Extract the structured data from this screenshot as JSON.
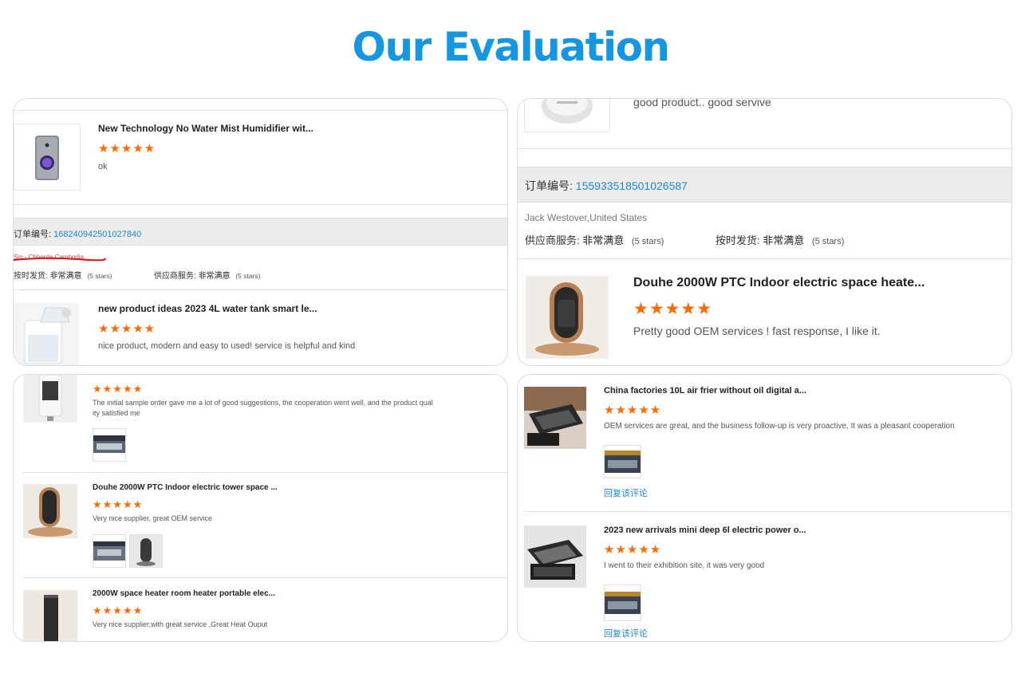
{
  "page": {
    "title": "Our Evaluation"
  },
  "card1": {
    "review1": {
      "name": "New Technology No Water Mist Humidifier wit...",
      "stars": "★★★★★",
      "text": "ok"
    },
    "order": {
      "label": "订单编号:",
      "number": "168240942501027840"
    },
    "buyer": "Sin - Chhorda,Cambodia",
    "ratings": {
      "delivery_label": "按时发货:",
      "delivery_value": "非常满意",
      "delivery_stars": "(5 stars)",
      "service_label": "供应商服务:",
      "service_value": "非常满意",
      "service_stars": "(5 stars)"
    },
    "review2": {
      "name": "new product ideas 2023 4L water tank smart le...",
      "stars": "★★★★★",
      "text": "nice product, modern and easy to used! service is helpful and kind"
    }
  },
  "card2": {
    "top_text": "good product.. good servive",
    "order": {
      "label": "订单编号:",
      "number": "155933518501026587"
    },
    "buyer": "Jack Westover,United States",
    "ratings": {
      "service_label": "供应商服务:",
      "service_value": "非常满意",
      "service_stars": "(5 stars)",
      "delivery_label": "按时发货:",
      "delivery_value": "非常满意",
      "delivery_stars": "(5 stars)"
    },
    "review": {
      "name": "Douhe 2000W PTC Indoor electric space heate...",
      "stars": "★★★★★",
      "text": "Pretty good OEM services !  fast response, I like it."
    }
  },
  "card3": {
    "review1": {
      "stars": "★★★★★",
      "text_line1": "The initial sample order gave me a lot of good suggestions, the cooperation went well, and the product qual",
      "text_line2": "ity satisfied me"
    },
    "review2": {
      "name": "Douhe 2000W PTC Indoor electric tower space ...",
      "stars": "★★★★★",
      "text": "Very nice supplier, great OEM service"
    },
    "review3": {
      "name": "2000W space heater room heater portable elec...",
      "stars": "★★★★★",
      "text": "Very nice supplier,with great service ,Great Heat Ouput"
    }
  },
  "card4": {
    "review1": {
      "name": "China factories 10L air frier without oil digital a...",
      "stars": "★★★★★",
      "text": "OEM services are great, and the business follow-up is very proactive. It was a pleasant cooperation",
      "reply": "回复该评论"
    },
    "review2": {
      "name": "2023 new arrivals mini deep 6l electric power o...",
      "stars": "★★★★★",
      "text": "I went to their exhibition site, it was very good",
      "reply": "回复该评论"
    }
  },
  "colors": {
    "accent": "#1496e0",
    "star": "#ff6a00",
    "link": "#1e88d0",
    "order_bar": "#ececec",
    "buyer_strike": "#dd1111"
  }
}
